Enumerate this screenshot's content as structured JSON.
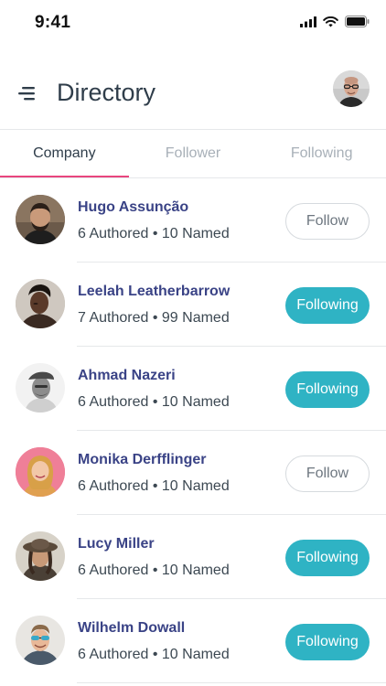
{
  "status_bar": {
    "time": "9:41"
  },
  "header": {
    "title": "Directory",
    "menu_icon": "menu-icon",
    "avatar_icon": "profile-avatar"
  },
  "tabs": [
    {
      "label": "Company",
      "active": true
    },
    {
      "label": "Follower",
      "active": false
    },
    {
      "label": "Following",
      "active": false
    }
  ],
  "people": [
    {
      "name": "Hugo Assunção",
      "stats": "6 Authored • 10 Named",
      "button": "Follow",
      "following": false
    },
    {
      "name": "Leelah Leatherbarrow",
      "stats": "7 Authored • 99 Named",
      "button": "Following",
      "following": true
    },
    {
      "name": "Ahmad Nazeri",
      "stats": "6 Authored • 10 Named",
      "button": "Following",
      "following": true
    },
    {
      "name": "Monika Derfflinger",
      "stats": "6 Authored • 10 Named",
      "button": "Follow",
      "following": false
    },
    {
      "name": "Lucy Miller",
      "stats": "6 Authored • 10 Named",
      "button": "Following",
      "following": true
    },
    {
      "name": "Wilhelm Dowall",
      "stats": "6 Authored • 10 Named",
      "button": "Following",
      "following": true
    }
  ],
  "colors": {
    "accent": "#2fb3c4",
    "tab_indicator": "#e8457e",
    "name_text": "#3a4386"
  }
}
